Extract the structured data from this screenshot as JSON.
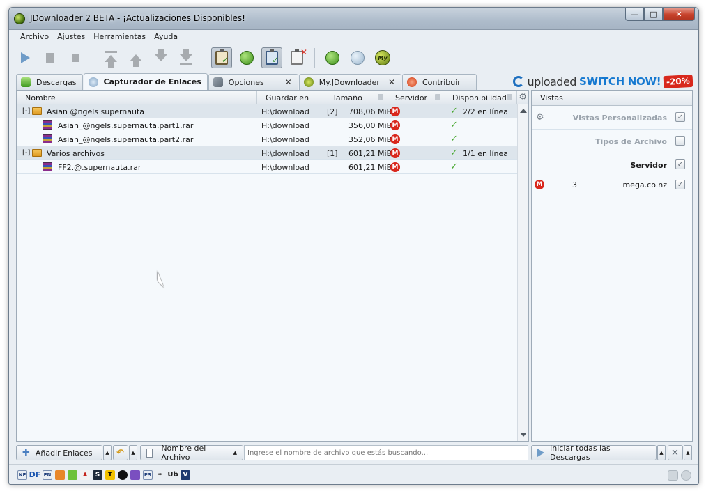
{
  "window": {
    "title": "JDownloader 2 BETA - ¡Actualizaciones Disponibles!"
  },
  "menu": [
    "Archivo",
    "Ajustes",
    "Herramientas",
    "Ayuda"
  ],
  "tabs": [
    {
      "label": "Descargas",
      "closable": false
    },
    {
      "label": "Capturador de Enlaces",
      "closable": false,
      "active": true
    },
    {
      "label": "Opciones",
      "closable": true
    },
    {
      "label": "My.JDownloader",
      "closable": true
    },
    {
      "label": "Contribuir",
      "closable": false
    }
  ],
  "banner": {
    "brand": "uploaded",
    "cta": "SWITCH NOW!",
    "discount": "-20%"
  },
  "table": {
    "columns": [
      "Nombre",
      "Guardar en",
      "Tamaño",
      "Servidor",
      "Disponibilidad"
    ],
    "rows": [
      {
        "type": "package",
        "name": "Asian @ngels supernauta",
        "save_to": "H:\\download",
        "count": "[2]",
        "size": "708,06 MiB",
        "availability": "2/2 en línea"
      },
      {
        "type": "file",
        "name": "Asian_@ngels.supernauta.part1.rar",
        "save_to": "H:\\download",
        "count": "",
        "size": "356,00 MiB",
        "availability": ""
      },
      {
        "type": "file",
        "name": "Asian_@ngels.supernauta.part2.rar",
        "save_to": "H:\\download",
        "count": "",
        "size": "352,06 MiB",
        "availability": ""
      },
      {
        "type": "package",
        "name": "Varios archivos",
        "save_to": "H:\\download",
        "count": "[1]",
        "size": "601,21 MiB",
        "availability": "1/1 en línea"
      },
      {
        "type": "file",
        "name": "FF2.@.supernauta.rar",
        "save_to": "H:\\download",
        "count": "",
        "size": "601,21 MiB",
        "availability": ""
      }
    ],
    "expand_symbol": "[-]",
    "host_icon_letter": "M"
  },
  "sidebar": {
    "title": "Vistas",
    "views_label": "Vistas Personalizadas",
    "file_types_label": "Tipos de Archivo",
    "server_label": "Servidor",
    "server_entry": {
      "count": "3",
      "host": "mega.co.nz"
    }
  },
  "bottom": {
    "add_links": "Añadir Enlaces",
    "search_field_label": "Nombre del Archivo",
    "search_placeholder": "Ingrese el nombre de archivo que estás buscando...",
    "start_all": "Iniciar todas las Descargas"
  },
  "status_icons": [
    "NF",
    "DF",
    "FN",
    "S",
    "T",
    "PS",
    "Ub",
    "V"
  ],
  "colors": {
    "accent": "#1478d0",
    "mega_red": "#d9271c",
    "ok_green": "#4aa832"
  }
}
